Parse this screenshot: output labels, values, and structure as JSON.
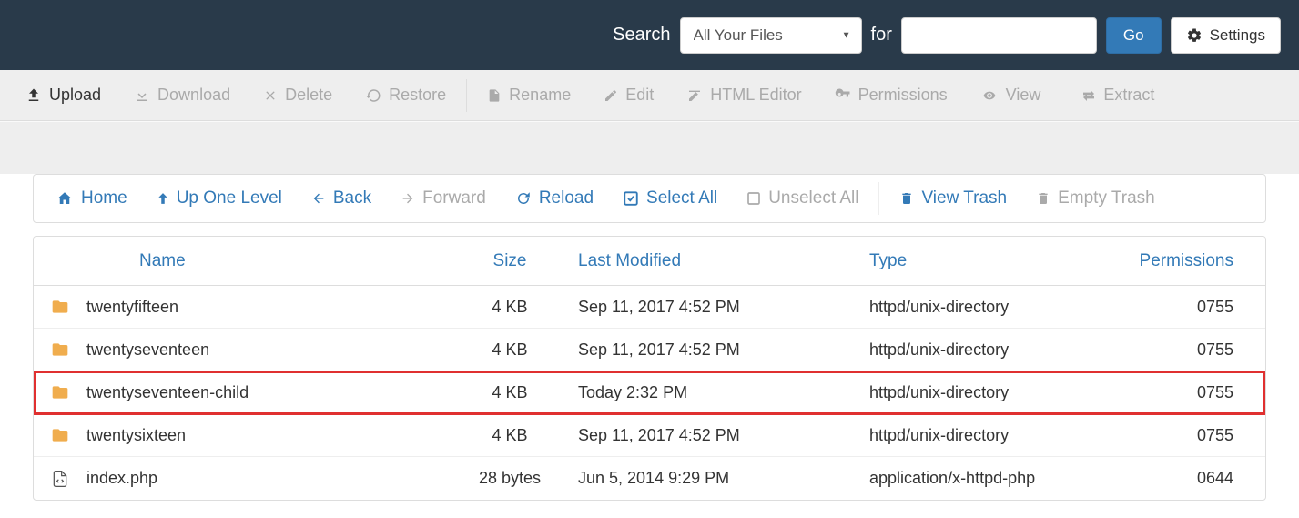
{
  "topbar": {
    "search_label": "Search",
    "for_label": "for",
    "search_scope": "All Your Files",
    "search_value": "",
    "go_label": "Go",
    "settings_label": "Settings"
  },
  "toolbar": {
    "upload": "Upload",
    "download": "Download",
    "delete": "Delete",
    "restore": "Restore",
    "rename": "Rename",
    "edit": "Edit",
    "html_editor": "HTML Editor",
    "permissions": "Permissions",
    "view": "View",
    "extract": "Extract"
  },
  "navbar": {
    "home": "Home",
    "up": "Up One Level",
    "back": "Back",
    "forward": "Forward",
    "reload": "Reload",
    "select_all": "Select All",
    "unselect_all": "Unselect All",
    "view_trash": "View Trash",
    "empty_trash": "Empty Trash"
  },
  "table": {
    "headers": {
      "name": "Name",
      "size": "Size",
      "last_modified": "Last Modified",
      "type": "Type",
      "permissions": "Permissions"
    },
    "rows": [
      {
        "icon": "folder",
        "name": "twentyfifteen",
        "size": "4 KB",
        "modified": "Sep 11, 2017 4:52 PM",
        "type": "httpd/unix-directory",
        "perm": "0755",
        "highlighted": false
      },
      {
        "icon": "folder",
        "name": "twentyseventeen",
        "size": "4 KB",
        "modified": "Sep 11, 2017 4:52 PM",
        "type": "httpd/unix-directory",
        "perm": "0755",
        "highlighted": false
      },
      {
        "icon": "folder",
        "name": "twentyseventeen-child",
        "size": "4 KB",
        "modified": "Today 2:32 PM",
        "type": "httpd/unix-directory",
        "perm": "0755",
        "highlighted": true
      },
      {
        "icon": "folder",
        "name": "twentysixteen",
        "size": "4 KB",
        "modified": "Sep 11, 2017 4:52 PM",
        "type": "httpd/unix-directory",
        "perm": "0755",
        "highlighted": false
      },
      {
        "icon": "file-code",
        "name": "index.php",
        "size": "28 bytes",
        "modified": "Jun 5, 2014 9:29 PM",
        "type": "application/x-httpd-php",
        "perm": "0644",
        "highlighted": false
      }
    ]
  }
}
